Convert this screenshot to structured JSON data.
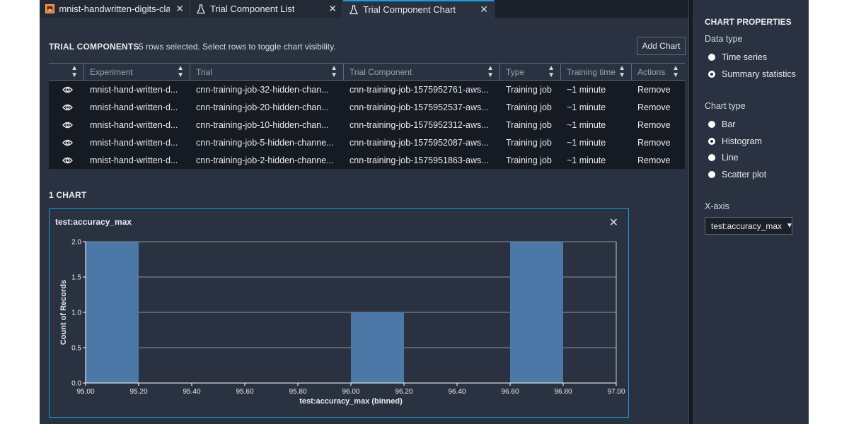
{
  "tabs": [
    {
      "label": "mnist-handwritten-digits-clas",
      "icon": "notebook-icon",
      "active": false
    },
    {
      "label": "Trial Component List",
      "icon": "flask-icon",
      "active": false
    },
    {
      "label": "Trial Component Chart",
      "icon": "flask-icon",
      "active": true
    }
  ],
  "trial_components": {
    "title": "TRIAL COMPONENTS",
    "subtitle": "5 rows selected. Select rows to toggle chart visibility.",
    "add_chart_label": "Add Chart",
    "columns": [
      "",
      "Experiment",
      "Trial",
      "Trial Component",
      "Type",
      "Training time",
      "Actions"
    ],
    "rows": [
      {
        "experiment": "mnist-hand-written-d...",
        "trial": "cnn-training-job-32-hidden-chan...",
        "component": "cnn-training-job-1575952761-aws...",
        "type": "Training job",
        "time": "~1 minute",
        "action": "Remove"
      },
      {
        "experiment": "mnist-hand-written-d...",
        "trial": "cnn-training-job-20-hidden-chan...",
        "component": "cnn-training-job-1575952537-aws...",
        "type": "Training job",
        "time": "~1 minute",
        "action": "Remove"
      },
      {
        "experiment": "mnist-hand-written-d...",
        "trial": "cnn-training-job-10-hidden-chan...",
        "component": "cnn-training-job-1575952312-aws...",
        "type": "Training job",
        "time": "~1 minute",
        "action": "Remove"
      },
      {
        "experiment": "mnist-hand-written-d...",
        "trial": "cnn-training-job-5-hidden-channe...",
        "component": "cnn-training-job-1575952087-aws...",
        "type": "Training job",
        "time": "~1 minute",
        "action": "Remove"
      },
      {
        "experiment": "mnist-hand-written-d...",
        "trial": "cnn-training-job-2-hidden-channe...",
        "component": "cnn-training-job-1575951863-aws...",
        "type": "Training job",
        "time": "~1 minute",
        "action": "Remove"
      }
    ]
  },
  "charts_section": {
    "title": "1 CHART"
  },
  "chart_data": {
    "type": "bar",
    "title": "test:accuracy_max",
    "xlabel": "test:accuracy_max (binned)",
    "ylabel": "Count of Records",
    "xlim": [
      95.0,
      97.0
    ],
    "ylim": [
      0,
      2.0
    ],
    "x_ticks": [
      "95.00",
      "95.20",
      "95.40",
      "95.60",
      "95.80",
      "96.00",
      "96.20",
      "96.40",
      "96.60",
      "96.80",
      "97.00"
    ],
    "y_ticks": [
      "0.0",
      "0.5",
      "1.0",
      "1.5",
      "2.0"
    ],
    "bins": [
      {
        "start": 95.0,
        "end": 95.2,
        "count": 2
      },
      {
        "start": 96.0,
        "end": 96.2,
        "count": 1
      },
      {
        "start": 96.6,
        "end": 96.8,
        "count": 2
      }
    ],
    "bar_color": "#4c78a8",
    "grid": true
  },
  "properties": {
    "title": "CHART PROPERTIES",
    "data_type_label": "Data type",
    "data_types": [
      {
        "label": "Time series",
        "selected": false
      },
      {
        "label": "Summary statistics",
        "selected": true
      }
    ],
    "chart_type_label": "Chart type",
    "chart_types": [
      {
        "label": "Bar",
        "selected": false
      },
      {
        "label": "Histogram",
        "selected": true
      },
      {
        "label": "Line",
        "selected": false
      },
      {
        "label": "Scatter plot",
        "selected": false
      }
    ],
    "xaxis_label": "X-axis",
    "xaxis_value": "test:accuracy_max"
  },
  "colors": {
    "accent": "#1a9ed8",
    "background": "#2a3241",
    "table_body": "#161b23"
  }
}
